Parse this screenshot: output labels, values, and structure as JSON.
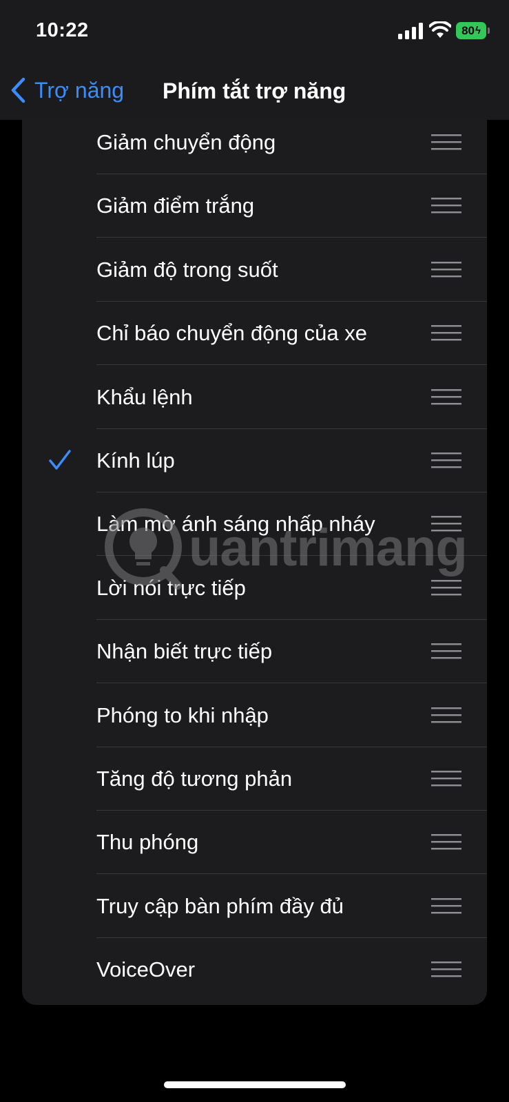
{
  "status_bar": {
    "time": "10:22",
    "battery": "80"
  },
  "nav": {
    "back_label": "Trợ năng",
    "title": "Phím tắt trợ năng"
  },
  "items": [
    {
      "label": "Giảm chuyển động",
      "checked": false
    },
    {
      "label": "Giảm điểm trắng",
      "checked": false
    },
    {
      "label": "Giảm độ trong suốt",
      "checked": false
    },
    {
      "label": "Chỉ báo chuyển động của xe",
      "checked": false
    },
    {
      "label": "Khẩu lệnh",
      "checked": false
    },
    {
      "label": "Kính lúp",
      "checked": true
    },
    {
      "label": "Làm mờ ánh sáng nhấp nháy",
      "checked": false
    },
    {
      "label": "Lời nói trực tiếp",
      "checked": false
    },
    {
      "label": "Nhận biết trực tiếp",
      "checked": false
    },
    {
      "label": "Phóng to khi nhập",
      "checked": false
    },
    {
      "label": "Tăng độ tương phản",
      "checked": false
    },
    {
      "label": "Thu phóng",
      "checked": false
    },
    {
      "label": "Truy cập bàn phím đầy đủ",
      "checked": false
    },
    {
      "label": "VoiceOver",
      "checked": false
    }
  ],
  "watermark": {
    "text": "uantrimang"
  },
  "colors": {
    "accent": "#3a8dfb",
    "battery": "#33c759",
    "card": "#1c1c1e"
  }
}
